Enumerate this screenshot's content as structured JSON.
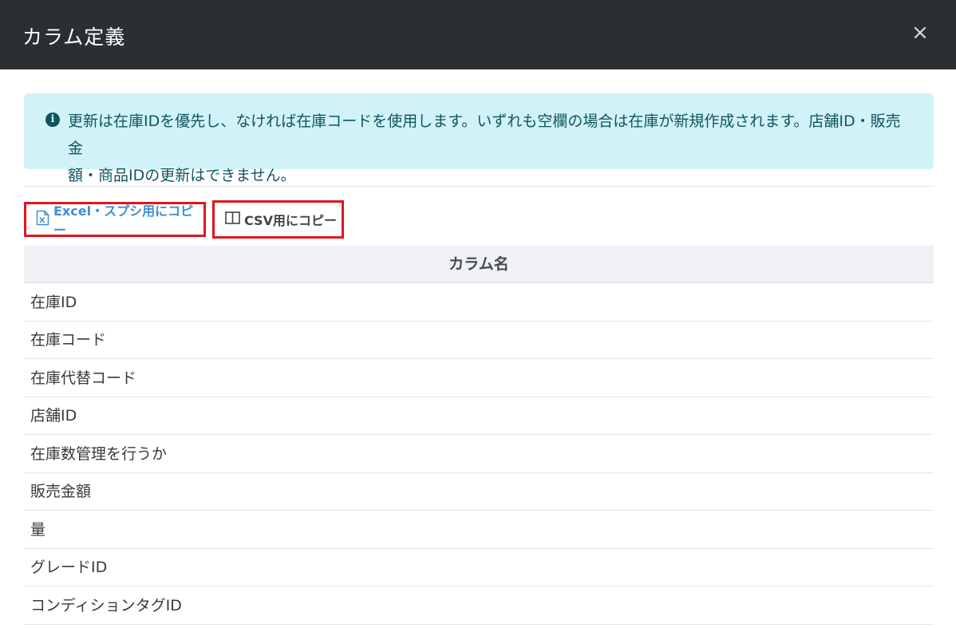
{
  "modal": {
    "title": "カラム定義",
    "close_label": "×"
  },
  "alert": {
    "icon": "info-circle-icon",
    "icon_glyph": "i",
    "line1": "更新は在庫IDを優先し、なければ在庫コードを使用します。いずれも空欄の場合は在庫が新規作成されます。店舗ID・販売金",
    "line2": "額・商品IDの更新はできません。"
  },
  "buttons": {
    "excel_label": "Excel・スプシ用にコピー",
    "csv_label": "CSV用にコピー"
  },
  "table": {
    "header": "カラム名",
    "rows": [
      "在庫ID",
      "在庫コード",
      "在庫代替コード",
      "店舗ID",
      "在庫数管理を行うか",
      "販売金額",
      "量",
      "グレードID",
      "コンディションタグID"
    ]
  },
  "colors": {
    "header_bg": "#2b2f33",
    "alert_bg": "#d1f3f7",
    "alert_text": "#0f5560",
    "excel_link": "#3d8fd6",
    "highlight_border": "#e0161c"
  }
}
